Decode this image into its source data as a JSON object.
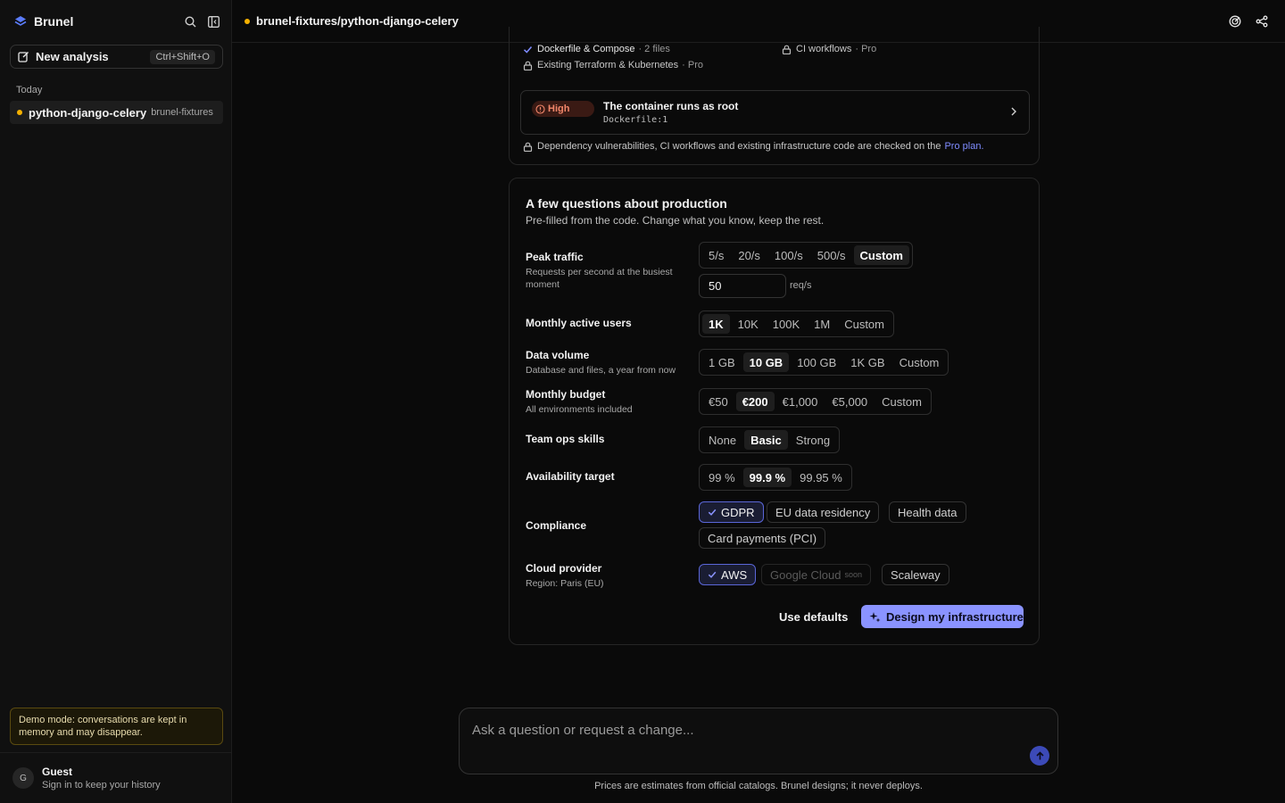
{
  "sidebar": {
    "brand": "Brunel",
    "new_analysis": {
      "label": "New analysis",
      "shortcut": "Ctrl+Shift+O"
    },
    "section": "Today",
    "history": [
      {
        "name": "python-django-celery",
        "owner": "brunel-fixtures"
      }
    ],
    "demo_note": "Demo mode: conversations are kept in memory and may disappear.",
    "user": {
      "initial": "G",
      "name": "Guest",
      "sub": "Sign in to keep your history"
    }
  },
  "topbar": {
    "repo": "brunel-fixtures/python-django-celery"
  },
  "scan": {
    "features": [
      {
        "label": "Dockerfile & Compose",
        "sub": "· 2 files",
        "status": "check"
      },
      {
        "label": "CI workflows",
        "sub": "· Pro",
        "status": "lock"
      },
      {
        "label": "Existing Terraform & Kubernetes",
        "sub": "· Pro",
        "status": "lock"
      }
    ],
    "finding": {
      "severity": "High",
      "title": "The container runs as root",
      "location": "Dockerfile:1"
    },
    "pro_note": "Dependency vulnerabilities, CI workflows and existing infrastructure code are checked on the",
    "pro_link": "Pro plan."
  },
  "questions": {
    "title": "A few questions about production",
    "subtitle": "Pre-filled from the code. Change what you know, keep the rest.",
    "peak_traffic": {
      "label": "Peak traffic",
      "desc": "Requests per second at the busiest moment",
      "options": [
        "5/s",
        "20/s",
        "100/s",
        "500/s",
        "Custom"
      ],
      "selected": "Custom",
      "custom_value": "50",
      "unit": "req/s"
    },
    "mau": {
      "label": "Monthly active users",
      "options": [
        "1K",
        "10K",
        "100K",
        "1M",
        "Custom"
      ],
      "selected": "1K"
    },
    "data_volume": {
      "label": "Data volume",
      "desc": "Database and files, a year from now",
      "options": [
        "1 GB",
        "10 GB",
        "100 GB",
        "1K GB",
        "Custom"
      ],
      "selected": "10 GB"
    },
    "budget": {
      "label": "Monthly budget",
      "desc": "All environments included",
      "options": [
        "€50",
        "€200",
        "€1,000",
        "€5,000",
        "Custom"
      ],
      "selected": "€200"
    },
    "ops_skills": {
      "label": "Team ops skills",
      "options": [
        "None",
        "Basic",
        "Strong"
      ],
      "selected": "Basic"
    },
    "availability": {
      "label": "Availability target",
      "options": [
        "99 %",
        "99.9 %",
        "99.95 %"
      ],
      "selected": "99.9 %"
    },
    "compliance": {
      "label": "Compliance",
      "options": [
        "GDPR",
        "EU data residency",
        "Health data",
        "Card payments (PCI)"
      ],
      "checked": [
        "GDPR"
      ]
    },
    "cloud": {
      "label": "Cloud provider",
      "desc": "Region: Paris (EU)",
      "options": [
        "AWS",
        "Google Cloud",
        "Scaleway"
      ],
      "selected": "AWS",
      "soon_label": "soon"
    },
    "use_defaults": "Use defaults",
    "design_button": "Design my infrastructure"
  },
  "composer": {
    "placeholder": "Ask a question or request a change...",
    "disclaimer": "Prices are estimates from official catalogs. Brunel designs; it never deploys."
  }
}
